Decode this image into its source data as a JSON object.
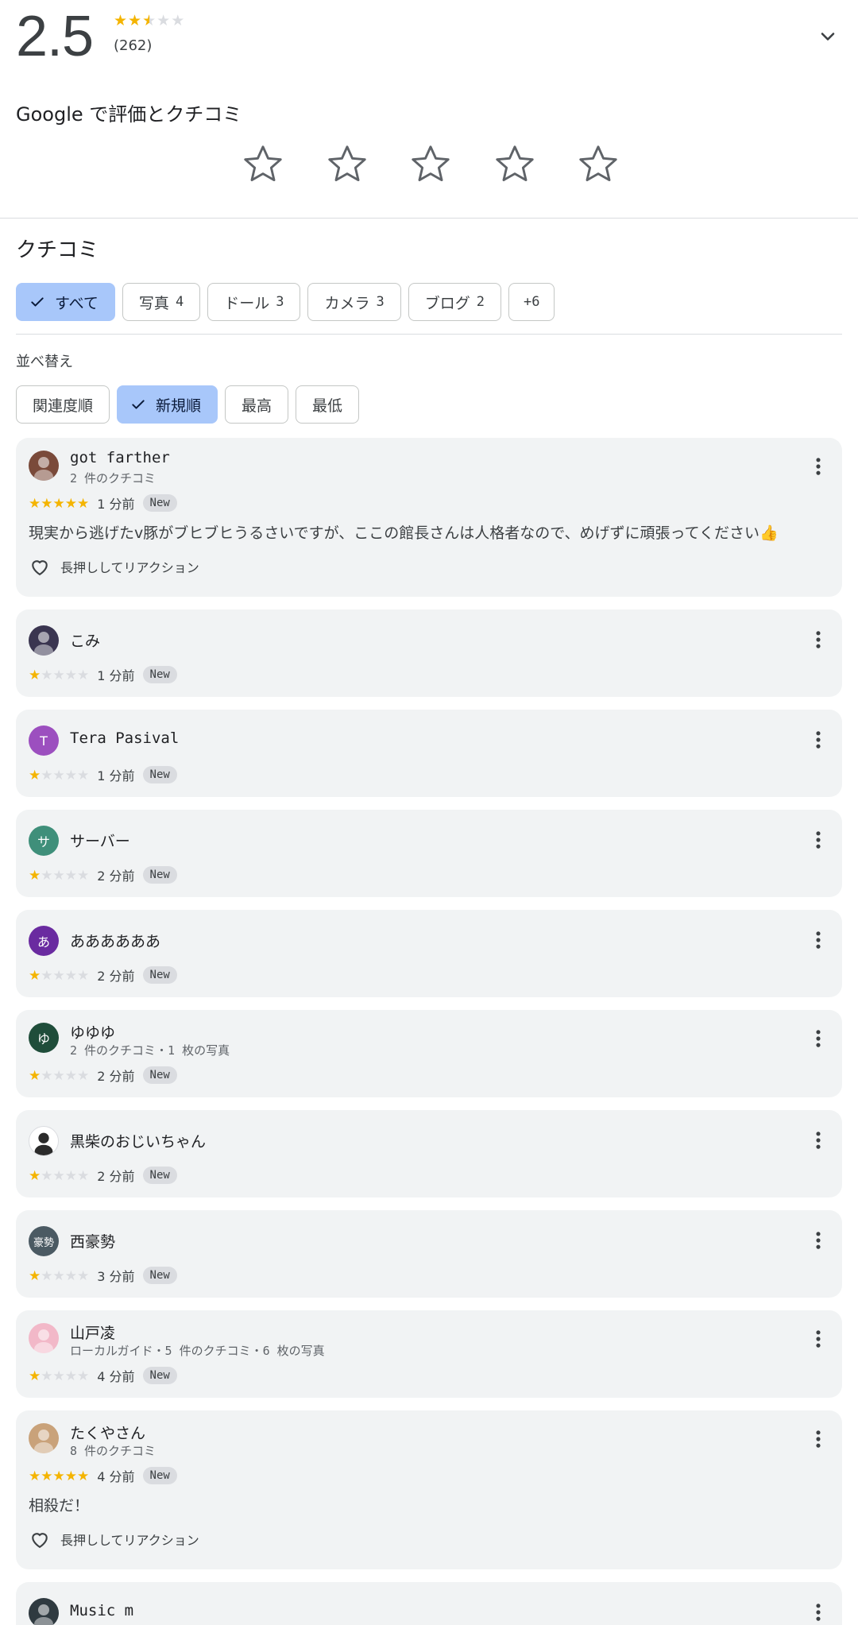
{
  "summary": {
    "score": "2.5",
    "stars_value": 2.5,
    "count": "(262)"
  },
  "rate": {
    "title": "Google で評価とクチコミ"
  },
  "reviews_section": {
    "title": "クチコミ",
    "filters": [
      {
        "label": "すべて",
        "count": "",
        "active": true
      },
      {
        "label": "写真",
        "count": "4",
        "active": false
      },
      {
        "label": "ドール",
        "count": "3",
        "active": false
      },
      {
        "label": "カメラ",
        "count": "3",
        "active": false
      },
      {
        "label": "ブログ",
        "count": "2",
        "active": false
      },
      {
        "label": "+6",
        "count": "",
        "active": false
      }
    ],
    "sort_label": "並べ替え",
    "sorts": [
      {
        "label": "関連度順",
        "active": false
      },
      {
        "label": "新規順",
        "active": true
      },
      {
        "label": "最高",
        "active": false
      },
      {
        "label": "最低",
        "active": false
      }
    ]
  },
  "reviews": [
    {
      "name": "got farther",
      "sub": "2 件のクチコミ",
      "stars": 5,
      "time": "1 分前",
      "badge": "New",
      "text": "現実から逃げたv豚がブヒブヒうるさいですが、ここの館長さんは人格者なので、めげずに頑張ってください👍",
      "reaction": "長押ししてリアクション",
      "avatar": {
        "letter": "",
        "color": "#7a4a3a"
      }
    },
    {
      "name": "こみ",
      "sub": "",
      "stars": 1,
      "time": "1 分前",
      "badge": "New",
      "text": "",
      "reaction": "",
      "avatar": {
        "letter": "",
        "color": "#3a3550"
      }
    },
    {
      "name": "Tera Pasival",
      "sub": "",
      "stars": 1,
      "time": "1 分前",
      "badge": "New",
      "text": "",
      "reaction": "",
      "avatar": {
        "letter": "T",
        "color": "#9c4fbf"
      }
    },
    {
      "name": "サーバー",
      "sub": "",
      "stars": 1,
      "time": "2 分前",
      "badge": "New",
      "text": "",
      "reaction": "",
      "avatar": {
        "letter": "サ",
        "color": "#3f8f7a"
      }
    },
    {
      "name": "ああああああ",
      "sub": "",
      "stars": 1,
      "time": "2 分前",
      "badge": "New",
      "text": "",
      "reaction": "",
      "avatar": {
        "letter": "あ",
        "color": "#6a2ba0"
      }
    },
    {
      "name": "ゆゆゆ",
      "sub": "2 件のクチコミ・1 枚の写真",
      "stars": 1,
      "time": "2 分前",
      "badge": "New",
      "text": "",
      "reaction": "",
      "avatar": {
        "letter": "ゆ",
        "color": "#1f4d3a"
      }
    },
    {
      "name": "黒柴のおじいちゃん",
      "sub": "",
      "stars": 1,
      "time": "2 分前",
      "badge": "New",
      "text": "",
      "reaction": "",
      "avatar": {
        "letter": "",
        "color": "#ffffff"
      }
    },
    {
      "name": "西豪勢",
      "sub": "",
      "stars": 1,
      "time": "3 分前",
      "badge": "New",
      "text": "",
      "reaction": "",
      "avatar": {
        "letter": "豪勢",
        "color": "#4b5a63"
      }
    },
    {
      "name": "山戸凌",
      "sub": "ローカルガイド・5 件のクチコミ・6 枚の写真",
      "stars": 1,
      "time": "4 分前",
      "badge": "New",
      "text": "",
      "reaction": "",
      "avatar": {
        "letter": "",
        "color": "#f2b8c8"
      }
    },
    {
      "name": "たくやさん",
      "sub": "8 件のクチコミ",
      "stars": 5,
      "time": "4 分前",
      "badge": "New",
      "text": "相殺だ！",
      "reaction": "長押ししてリアクション",
      "avatar": {
        "letter": "",
        "color": "#c9a27a"
      }
    },
    {
      "name": "Music m",
      "sub": "",
      "stars": 0,
      "time": "",
      "badge": "",
      "text": "",
      "reaction": "",
      "avatar": {
        "letter": "",
        "color": "#2f3a40"
      }
    }
  ]
}
